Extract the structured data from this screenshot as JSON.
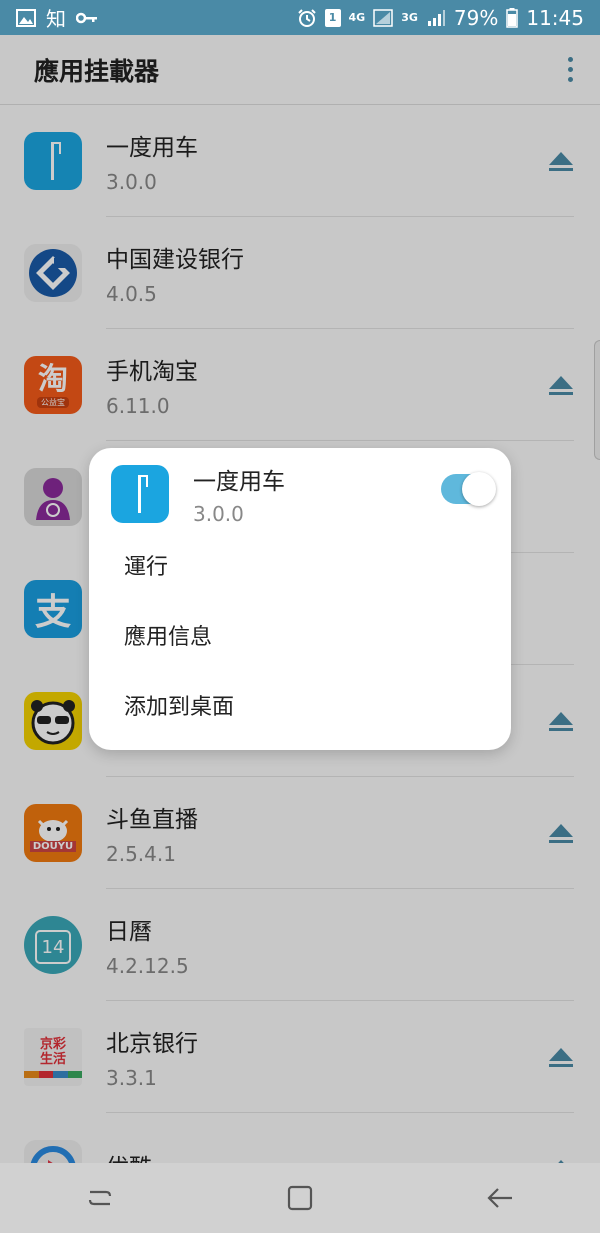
{
  "status_bar": {
    "left_label": "知",
    "sim_badge": "1",
    "net_4g": "4G",
    "net_3g": "3G",
    "battery": "79%",
    "time": "11:45"
  },
  "app_bar": {
    "title": "應用挂載器"
  },
  "apps": [
    {
      "name": "一度用车",
      "version": "3.0.0"
    },
    {
      "name": "中国建设银行",
      "version": "4.0.5"
    },
    {
      "name": "手机淘宝",
      "version": "6.11.0",
      "icon_text": "淘",
      "icon_sub": "公益宝"
    },
    {
      "name": "",
      "version": ""
    },
    {
      "name": "",
      "version": "",
      "icon_text": "支"
    },
    {
      "name": "",
      "version": ""
    },
    {
      "name": "斗鱼直播",
      "version": "2.5.4.1",
      "icon_text": "DOUYU"
    },
    {
      "name": "日曆",
      "version": "4.2.12.5",
      "icon_text": "14"
    },
    {
      "name": "北京银行",
      "version": "3.3.1",
      "icon_text": "京彩生活"
    },
    {
      "name": "优酷",
      "version": ""
    }
  ],
  "popup": {
    "app_name": "一度用车",
    "app_version": "3.0.0",
    "toggle_on": true,
    "items": [
      "運行",
      "應用信息",
      "添加到桌面"
    ]
  },
  "colors": {
    "accent": "#4a8aa6",
    "toggle": "#5fb8dc"
  }
}
